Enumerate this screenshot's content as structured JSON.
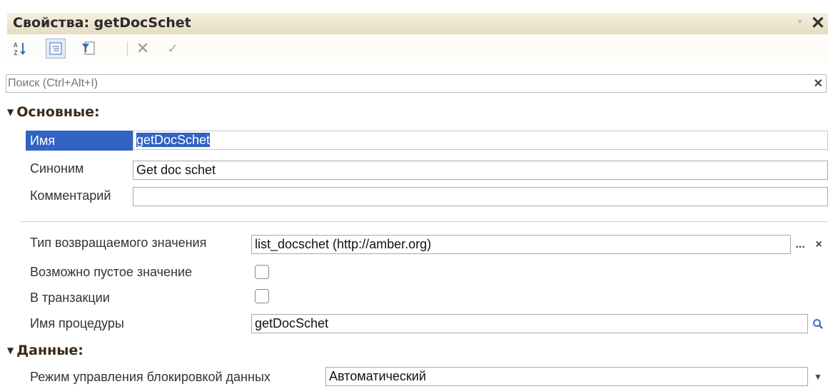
{
  "window": {
    "title": "Свойства: getDocSchet"
  },
  "search": {
    "placeholder": "Поиск (Ctrl+Alt+I)"
  },
  "sections": {
    "main": "Основные:",
    "data": "Данные:"
  },
  "props": {
    "name_label": "Имя",
    "name_value": "getDocSchet",
    "synonym_label": "Синоним",
    "synonym_value": "Get doc schet",
    "comment_label": "Комментарий",
    "comment_value": "",
    "return_type_label": "Тип возвращаемого значения",
    "return_type_value": "list_docschet (http://amber.org)",
    "nullable_label": "Возможно пустое значение",
    "transaction_label": "В транзакции",
    "procedure_label": "Имя процедуры",
    "procedure_value": "getDocSchet",
    "lock_mode_label": "Режим управления блокировкой данных",
    "lock_mode_value": "Автоматический"
  },
  "buttons": {
    "ellipsis": "...",
    "clear": "×"
  },
  "icons": {
    "sort": "sort-az-icon",
    "categories": "categories-icon",
    "filter": "filter-icon",
    "cancel": "cancel-icon",
    "apply": "apply-icon",
    "pin": "pin-icon",
    "close": "close-icon",
    "search": "search-icon",
    "dropdown": "dropdown-arrow-icon"
  },
  "colors": {
    "selection": "#3162c4",
    "title_bg": "#ece4cc"
  }
}
